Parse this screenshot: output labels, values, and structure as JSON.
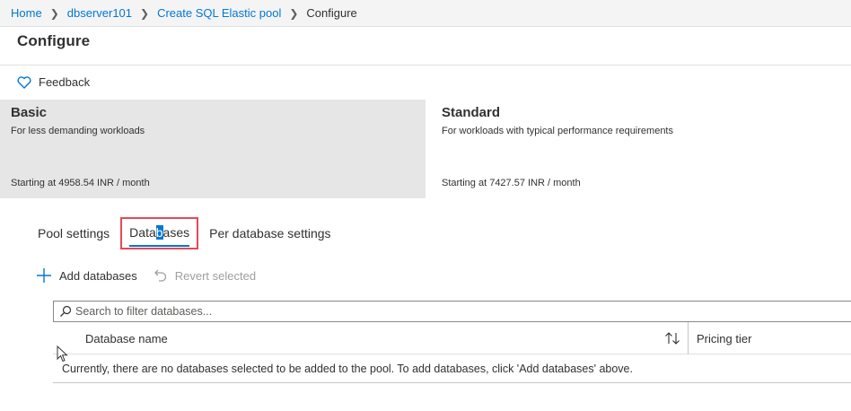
{
  "breadcrumb": {
    "items": [
      "Home",
      "dbserver101",
      "Create SQL Elastic pool"
    ],
    "current": "Configure"
  },
  "page": {
    "title": "Configure"
  },
  "feedback": {
    "label": "Feedback",
    "icon": "heart-icon"
  },
  "tiers": [
    {
      "name": "Basic",
      "description": "For less demanding workloads",
      "price": "Starting at 4958.54 INR / month",
      "selected": true
    },
    {
      "name": "Standard",
      "description": "For workloads with typical performance requirements",
      "price": "Starting at 7427.57 INR / month",
      "selected": false
    }
  ],
  "tabs": {
    "pool_settings": "Pool settings",
    "databases_pre": "Data",
    "databases_sel": "b",
    "databases_post": "ases",
    "per_database": "Per database settings"
  },
  "toolbar": {
    "add_label": "Add databases",
    "revert_label": "Revert selected"
  },
  "filter": {
    "placeholder": "Search to filter databases..."
  },
  "grid": {
    "columns": [
      "Database name",
      "Pricing tier"
    ],
    "empty_message": "Currently, there are no databases selected to be added to the pool. To add databases, click 'Add databases' above."
  },
  "colors": {
    "accent": "#0078d4",
    "highlight_border": "#e74856",
    "selected_tier_bg": "#e6e6e6"
  }
}
